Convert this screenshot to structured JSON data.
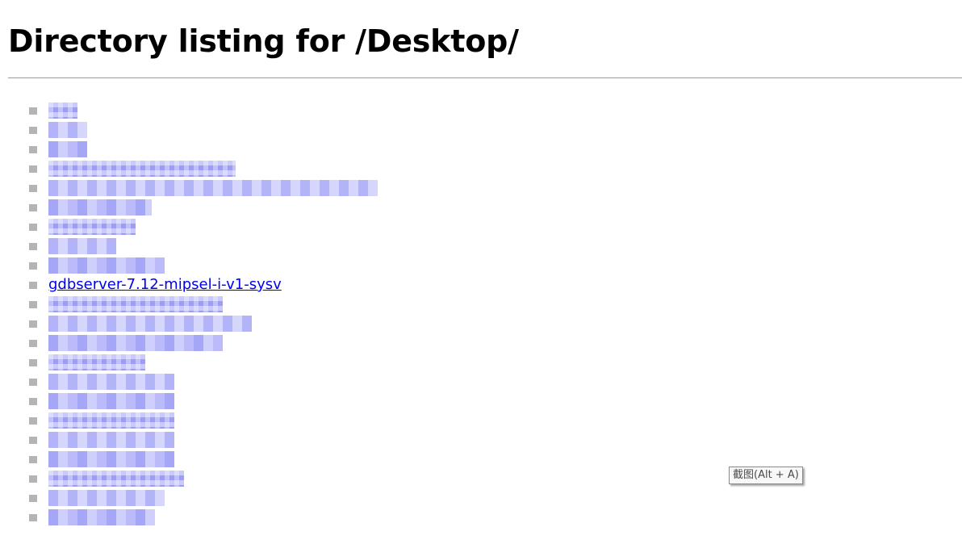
{
  "page": {
    "title": "Directory listing for /Desktop/"
  },
  "listing": {
    "visible_entry": "gdbserver-7.12-mipsel-i-v1-sysv"
  },
  "tooltip": {
    "text": "截图(Alt + A)"
  },
  "colors": {
    "link": "#0000ee",
    "bullet": "#b4b4b4",
    "redaction": "#a8a8f8"
  }
}
